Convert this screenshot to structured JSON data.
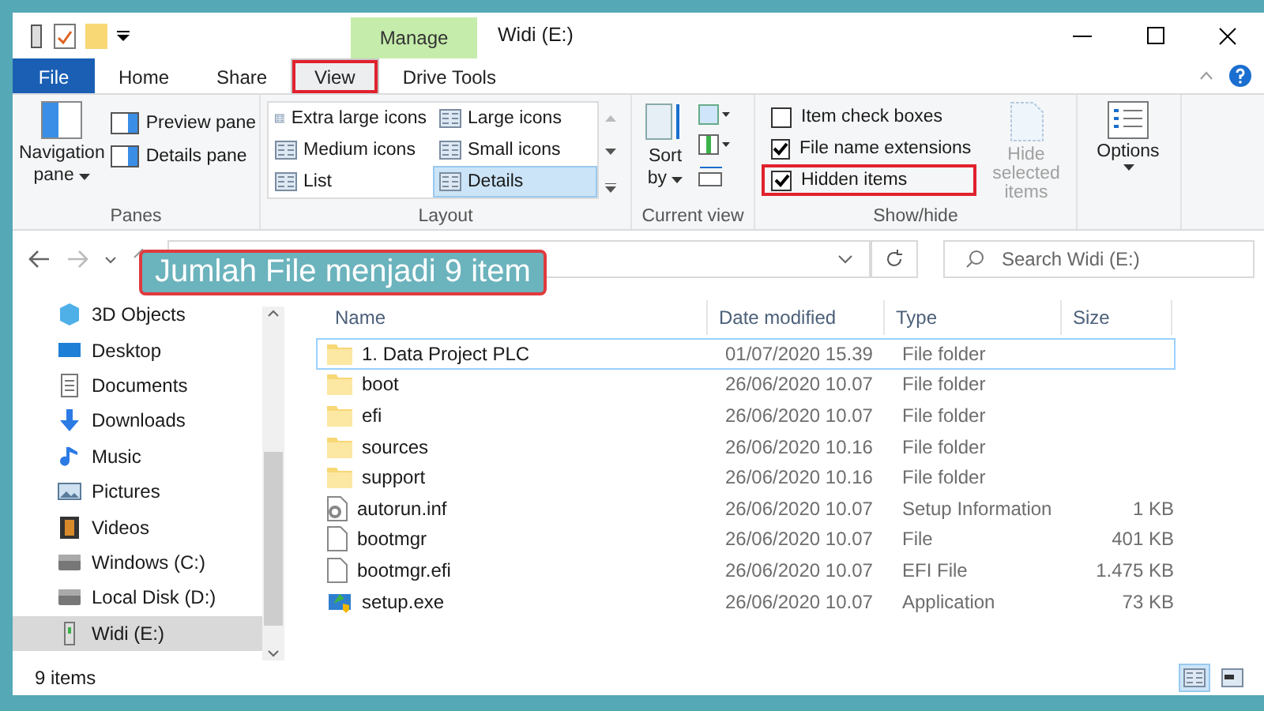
{
  "window": {
    "title": "Widi (E:)",
    "context_tab": "Manage"
  },
  "tabs": [
    {
      "label": "File",
      "kind": "file",
      "selected": false,
      "highlighted": false
    },
    {
      "label": "Home",
      "kind": "tab",
      "selected": false,
      "highlighted": false
    },
    {
      "label": "Share",
      "kind": "tab",
      "selected": false,
      "highlighted": false
    },
    {
      "label": "View",
      "kind": "tab",
      "selected": true,
      "highlighted": true
    },
    {
      "label": "Drive Tools",
      "kind": "tab",
      "selected": false,
      "highlighted": false
    }
  ],
  "ribbon": {
    "panes": {
      "label": "Panes",
      "navigation_pane": "Navigation pane",
      "items": [
        "Preview pane",
        "Details pane"
      ]
    },
    "layout": {
      "label": "Layout",
      "options": [
        {
          "label": "Extra large icons",
          "selected": false
        },
        {
          "label": "Large icons",
          "selected": false
        },
        {
          "label": "Medium icons",
          "selected": false
        },
        {
          "label": "Small icons",
          "selected": false
        },
        {
          "label": "List",
          "selected": false
        },
        {
          "label": "Details",
          "selected": true
        }
      ]
    },
    "current_view": {
      "label": "Current view",
      "sort_by": "Sort by"
    },
    "show_hide": {
      "label": "Show/hide",
      "checkboxes": [
        {
          "label": "Item check boxes",
          "checked": false,
          "highlighted": false
        },
        {
          "label": "File name extensions",
          "checked": true,
          "highlighted": false
        },
        {
          "label": "Hidden items",
          "checked": true,
          "highlighted": true
        }
      ],
      "hide_selected": {
        "label": "Hide selected items",
        "disabled": true
      }
    },
    "options": {
      "label": "Options"
    }
  },
  "search": {
    "placeholder": "Search Widi (E:)"
  },
  "callout": "Jumlah File menjadi 9 item",
  "sidebar": {
    "items": [
      {
        "label": "3D Objects",
        "kind": "cube",
        "selected": false
      },
      {
        "label": "Desktop",
        "kind": "desktop",
        "selected": false
      },
      {
        "label": "Documents",
        "kind": "document",
        "selected": false
      },
      {
        "label": "Downloads",
        "kind": "download",
        "selected": false
      },
      {
        "label": "Music",
        "kind": "music",
        "selected": false
      },
      {
        "label": "Pictures",
        "kind": "pictures",
        "selected": false
      },
      {
        "label": "Videos",
        "kind": "videos",
        "selected": false
      },
      {
        "label": "Windows (C:)",
        "kind": "drive",
        "selected": false
      },
      {
        "label": "Local Disk (D:)",
        "kind": "drive",
        "selected": false
      },
      {
        "label": "Widi (E:)",
        "kind": "usb",
        "selected": true
      }
    ]
  },
  "table": {
    "columns": [
      "Name",
      "Date modified",
      "Type",
      "Size"
    ],
    "rows": [
      {
        "name": "1. Data Project PLC",
        "date": "01/07/2020 15.39",
        "type": "File folder",
        "size": "",
        "kind": "folder",
        "focused": true
      },
      {
        "name": "boot",
        "date": "26/06/2020 10.07",
        "type": "File folder",
        "size": "",
        "kind": "folder",
        "focused": false
      },
      {
        "name": "efi",
        "date": "26/06/2020 10.07",
        "type": "File folder",
        "size": "",
        "kind": "folder",
        "focused": false
      },
      {
        "name": "sources",
        "date": "26/06/2020 10.16",
        "type": "File folder",
        "size": "",
        "kind": "folder",
        "focused": false
      },
      {
        "name": "support",
        "date": "26/06/2020 10.16",
        "type": "File folder",
        "size": "",
        "kind": "folder",
        "focused": false
      },
      {
        "name": "autorun.inf",
        "date": "26/06/2020 10.07",
        "type": "Setup Information",
        "size": "1 KB",
        "kind": "settings",
        "focused": false
      },
      {
        "name": "bootmgr",
        "date": "26/06/2020 10.07",
        "type": "File",
        "size": "401 KB",
        "kind": "file",
        "focused": false
      },
      {
        "name": "bootmgr.efi",
        "date": "26/06/2020 10.07",
        "type": "EFI File",
        "size": "1.475 KB",
        "kind": "file",
        "focused": false
      },
      {
        "name": "setup.exe",
        "date": "26/06/2020 10.07",
        "type": "Application",
        "size": "73 KB",
        "kind": "exe",
        "focused": false
      }
    ]
  },
  "status_bar": {
    "count": "9 items",
    "view_buttons": [
      {
        "kind": "details",
        "selected": true
      },
      {
        "kind": "large_icons",
        "selected": false
      }
    ]
  }
}
